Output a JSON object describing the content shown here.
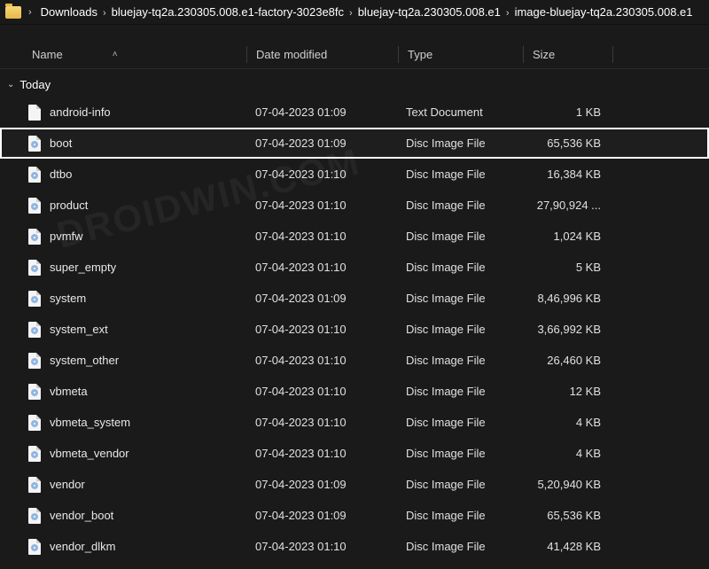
{
  "breadcrumb": {
    "items": [
      "Downloads",
      "bluejay-tq2a.230305.008.e1-factory-3023e8fc",
      "bluejay-tq2a.230305.008.e1",
      "image-bluejay-tq2a.230305.008.e1"
    ]
  },
  "columns": {
    "name": "Name",
    "date": "Date modified",
    "type": "Type",
    "size": "Size"
  },
  "group_label": "Today",
  "watermark": "DROIDWIN.COM",
  "highlight_index": 1,
  "files": [
    {
      "name": "android-info",
      "date": "07-04-2023 01:09",
      "type": "Text Document",
      "size": "1 KB",
      "icon": "text"
    },
    {
      "name": "boot",
      "date": "07-04-2023 01:09",
      "type": "Disc Image File",
      "size": "65,536 KB",
      "icon": "disc"
    },
    {
      "name": "dtbo",
      "date": "07-04-2023 01:10",
      "type": "Disc Image File",
      "size": "16,384 KB",
      "icon": "disc"
    },
    {
      "name": "product",
      "date": "07-04-2023 01:10",
      "type": "Disc Image File",
      "size": "27,90,924 ...",
      "icon": "disc"
    },
    {
      "name": "pvmfw",
      "date": "07-04-2023 01:10",
      "type": "Disc Image File",
      "size": "1,024 KB",
      "icon": "disc"
    },
    {
      "name": "super_empty",
      "date": "07-04-2023 01:10",
      "type": "Disc Image File",
      "size": "5 KB",
      "icon": "disc"
    },
    {
      "name": "system",
      "date": "07-04-2023 01:09",
      "type": "Disc Image File",
      "size": "8,46,996 KB",
      "icon": "disc"
    },
    {
      "name": "system_ext",
      "date": "07-04-2023 01:10",
      "type": "Disc Image File",
      "size": "3,66,992 KB",
      "icon": "disc"
    },
    {
      "name": "system_other",
      "date": "07-04-2023 01:10",
      "type": "Disc Image File",
      "size": "26,460 KB",
      "icon": "disc"
    },
    {
      "name": "vbmeta",
      "date": "07-04-2023 01:10",
      "type": "Disc Image File",
      "size": "12 KB",
      "icon": "disc"
    },
    {
      "name": "vbmeta_system",
      "date": "07-04-2023 01:10",
      "type": "Disc Image File",
      "size": "4 KB",
      "icon": "disc"
    },
    {
      "name": "vbmeta_vendor",
      "date": "07-04-2023 01:10",
      "type": "Disc Image File",
      "size": "4 KB",
      "icon": "disc"
    },
    {
      "name": "vendor",
      "date": "07-04-2023 01:09",
      "type": "Disc Image File",
      "size": "5,20,940 KB",
      "icon": "disc"
    },
    {
      "name": "vendor_boot",
      "date": "07-04-2023 01:09",
      "type": "Disc Image File",
      "size": "65,536 KB",
      "icon": "disc"
    },
    {
      "name": "vendor_dlkm",
      "date": "07-04-2023 01:10",
      "type": "Disc Image File",
      "size": "41,428 KB",
      "icon": "disc"
    }
  ]
}
